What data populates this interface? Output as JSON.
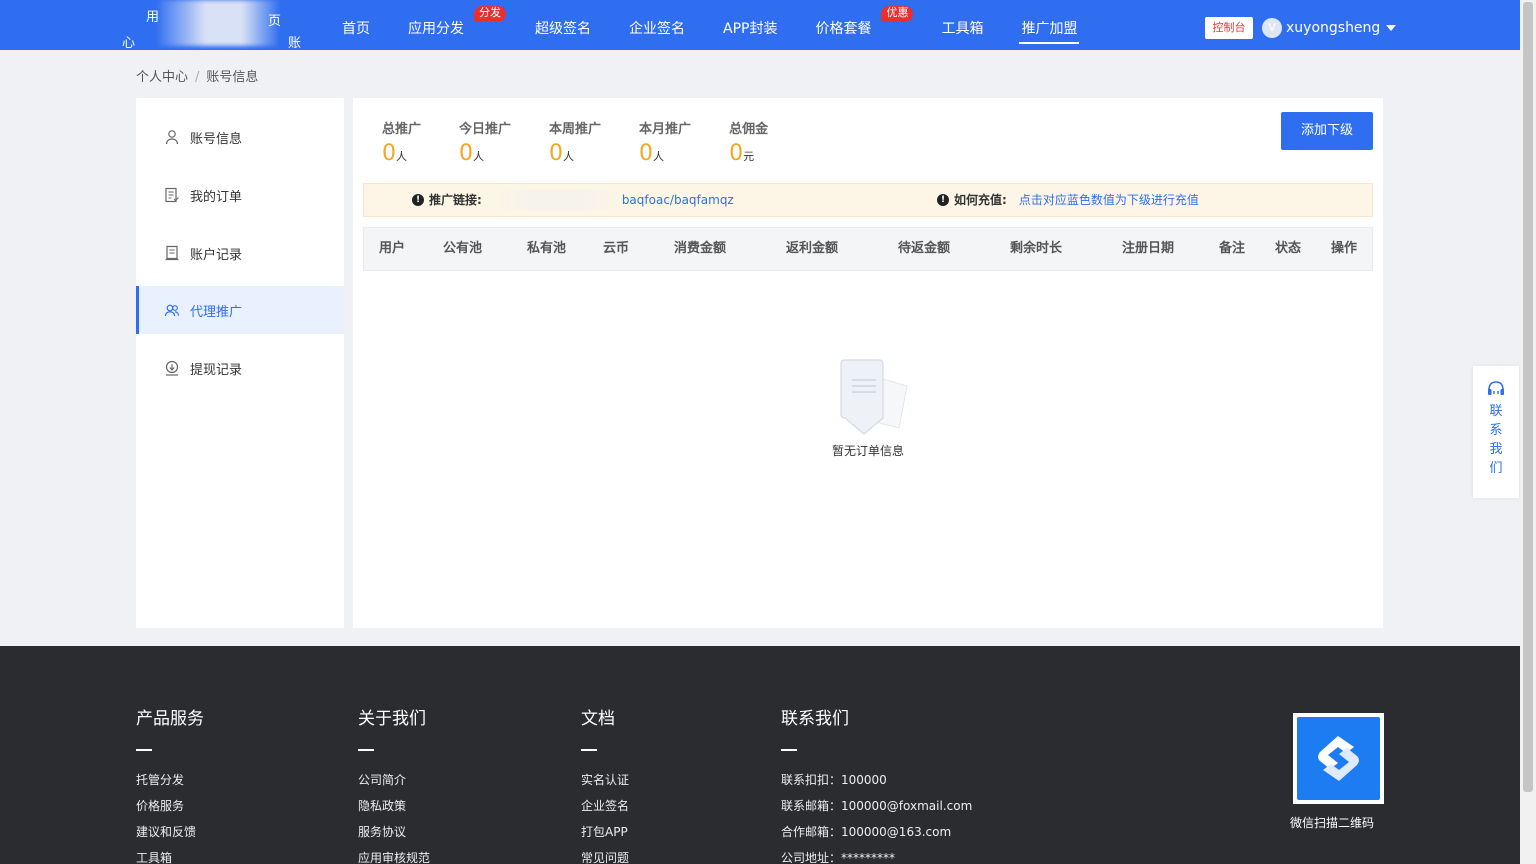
{
  "nav": {
    "items": [
      {
        "label": "首页",
        "badge": ""
      },
      {
        "label": "应用分发",
        "badge": "分发"
      },
      {
        "label": "超级签名",
        "badge": ""
      },
      {
        "label": "企业签名",
        "badge": ""
      },
      {
        "label": "APP封装",
        "badge": ""
      },
      {
        "label": "价格套餐",
        "badge": "优惠"
      },
      {
        "label": "工具箱",
        "badge": ""
      },
      {
        "label": "推广加盟",
        "badge": ""
      }
    ],
    "active_index": 7,
    "console_label": "控制台",
    "username": "xuyongsheng",
    "avatar_letter": "V"
  },
  "logo_fragments": [
    "心",
    "账",
    "页",
    "用"
  ],
  "breadcrumb": {
    "root": "个人中心",
    "separator": "/",
    "current": "账号信息"
  },
  "sidebar": {
    "items": [
      {
        "label": "账号信息",
        "icon": "user-icon"
      },
      {
        "label": "我的订单",
        "icon": "order-icon"
      },
      {
        "label": "账户记录",
        "icon": "record-icon"
      },
      {
        "label": "代理推广",
        "icon": "agent-icon"
      },
      {
        "label": "提现记录",
        "icon": "withdraw-icon"
      }
    ],
    "active_index": 3
  },
  "stats": [
    {
      "label": "总推广",
      "value": "0",
      "unit": "人"
    },
    {
      "label": "今日推广",
      "value": "0",
      "unit": "人"
    },
    {
      "label": "本周推广",
      "value": "0",
      "unit": "人"
    },
    {
      "label": "本月推广",
      "value": "0",
      "unit": "人"
    },
    {
      "label": "总佣金",
      "value": "0",
      "unit": "元"
    }
  ],
  "add_button": "添加下级",
  "notice": {
    "link_label": "推广链接:",
    "link_value": "baqfoac/baqfamqz",
    "recharge_label": "如何充值:",
    "recharge_text": "点击对应蓝色数值为下级进行充值"
  },
  "table": {
    "columns": [
      "用户",
      "公有池",
      "私有池",
      "云币",
      "消费金额",
      "返利金额",
      "待返金额",
      "剩余时长",
      "注册日期",
      "备注",
      "状态",
      "操作"
    ]
  },
  "empty_text": "暂无订单信息",
  "float_contact": {
    "chars": [
      "联",
      "系",
      "我",
      "们"
    ]
  },
  "footer": {
    "columns": [
      {
        "title": "产品服务",
        "items": [
          "托管分发",
          "价格服务",
          "建议和反馈",
          "工具箱"
        ]
      },
      {
        "title": "关于我们",
        "items": [
          "公司简介",
          "隐私政策",
          "服务协议",
          "应用审核规范"
        ]
      },
      {
        "title": "文档",
        "items": [
          "实名认证",
          "企业签名",
          "打包APP",
          "常见问题"
        ]
      },
      {
        "title": "联系我们",
        "items": [
          "联系扣扣：100000",
          "联系邮箱：100000@foxmail.com",
          "合作邮箱：100000@163.com",
          "公司地址：*********"
        ]
      }
    ],
    "qr_label": "微信扫描二维码"
  },
  "colors": {
    "primary": "#2f6ef0",
    "accent_orange": "#f5a623",
    "badge_red": "#e93030",
    "footer_bg": "#2b2c30"
  }
}
